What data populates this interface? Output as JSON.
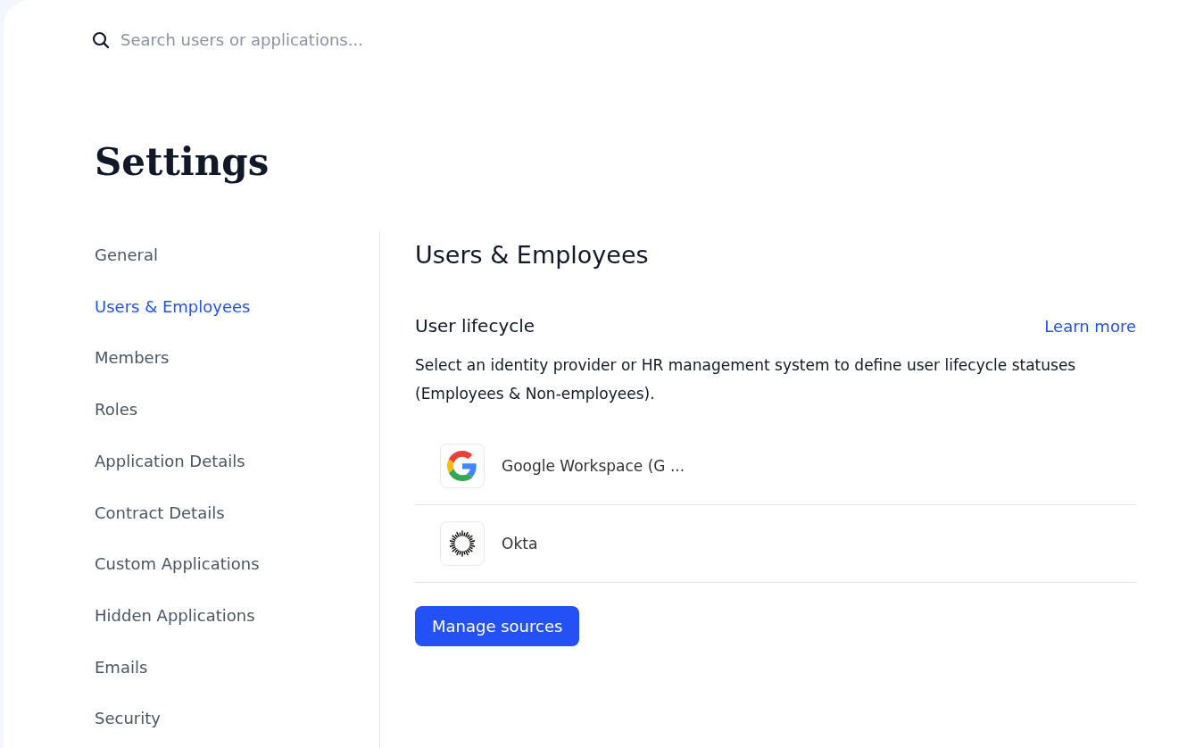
{
  "search": {
    "placeholder": "Search users or applications..."
  },
  "page_title": "Settings",
  "sidebar": {
    "items": [
      {
        "label": "General",
        "selected": false
      },
      {
        "label": "Users & Employees",
        "selected": true
      },
      {
        "label": "Members",
        "selected": false
      },
      {
        "label": "Roles",
        "selected": false
      },
      {
        "label": "Application Details",
        "selected": false
      },
      {
        "label": "Contract Details",
        "selected": false
      },
      {
        "label": "Custom Applications",
        "selected": false
      },
      {
        "label": "Hidden Applications",
        "selected": false
      },
      {
        "label": "Emails",
        "selected": false
      },
      {
        "label": "Security",
        "selected": false
      }
    ]
  },
  "content": {
    "title": "Users & Employees",
    "section": {
      "title": "User lifecycle",
      "link": "Learn more",
      "description": "Select an identity provider or HR management system to define user lifecycle statuses (Employees & Non-employees).",
      "sources": [
        {
          "kind": "google",
          "name": "Google Workspace (G ..."
        },
        {
          "kind": "okta",
          "name": "Okta"
        }
      ],
      "button": "Manage sources"
    }
  }
}
